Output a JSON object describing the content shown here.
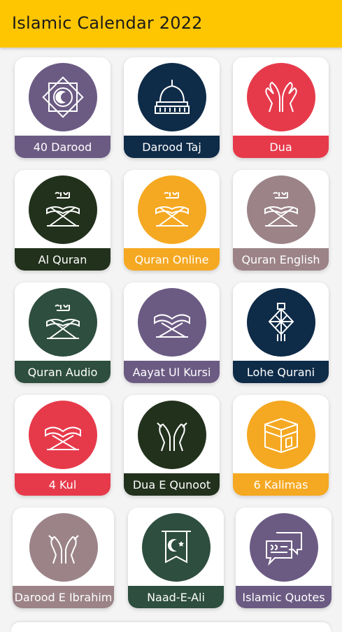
{
  "appbar": {
    "title": "Islamic Calendar 2022",
    "color": "#fec601"
  },
  "items": [
    {
      "label": "40 Darood",
      "icon": "darood-emblem-icon",
      "circle_color": "#6b5b83",
      "bar_color": "#6b5b83"
    },
    {
      "label": "Darood Taj",
      "icon": "mosque-dome-icon",
      "circle_color": "#0e2b48",
      "bar_color": "#0e2b48"
    },
    {
      "label": "Dua",
      "icon": "praying-hands-icon",
      "circle_color": "#e63a4b",
      "bar_color": "#e63a4b"
    },
    {
      "label": "Al Quran",
      "icon": "quran-stand-icon",
      "circle_color": "#22311c",
      "bar_color": "#22311c"
    },
    {
      "label": "Quran Online",
      "icon": "quran-stand-icon",
      "circle_color": "#f5a821",
      "bar_color": "#f5a821"
    },
    {
      "label": "Quran English",
      "icon": "quran-stand-icon",
      "circle_color": "#9b8388",
      "bar_color": "#9b8388"
    },
    {
      "label": "Quran Audio",
      "icon": "quran-stand-icon",
      "circle_color": "#2e4e3f",
      "bar_color": "#2e4e3f"
    },
    {
      "label": "Aayat Ul Kursi",
      "icon": "open-book-stand-icon",
      "circle_color": "#6b5b83",
      "bar_color": "#6b5b83"
    },
    {
      "label": "Lohe Qurani",
      "icon": "tasbih-tassel-icon",
      "circle_color": "#0e2b48",
      "bar_color": "#0e2b48"
    },
    {
      "label": "4 Kul",
      "icon": "open-book-stand-icon",
      "circle_color": "#e63a4b",
      "bar_color": "#e63a4b"
    },
    {
      "label": "Dua E Qunoot",
      "icon": "praying-hands-icon",
      "circle_color": "#22311c",
      "bar_color": "#22311c"
    },
    {
      "label": "6 Kalimas",
      "icon": "kaaba-icon",
      "circle_color": "#f5a821",
      "bar_color": "#f5a821"
    },
    {
      "label": "Darood E Ibrahim",
      "icon": "praying-hands-icon",
      "circle_color": "#9b8388",
      "bar_color": "#9b8388"
    },
    {
      "label": "Naad-E-Ali",
      "icon": "crescent-banner-icon",
      "circle_color": "#2e4e3f",
      "bar_color": "#2e4e3f"
    },
    {
      "label": "Islamic Quotes",
      "icon": "quote-bubbles-icon",
      "circle_color": "#6b5b83",
      "bar_color": "#6b5b83"
    }
  ]
}
